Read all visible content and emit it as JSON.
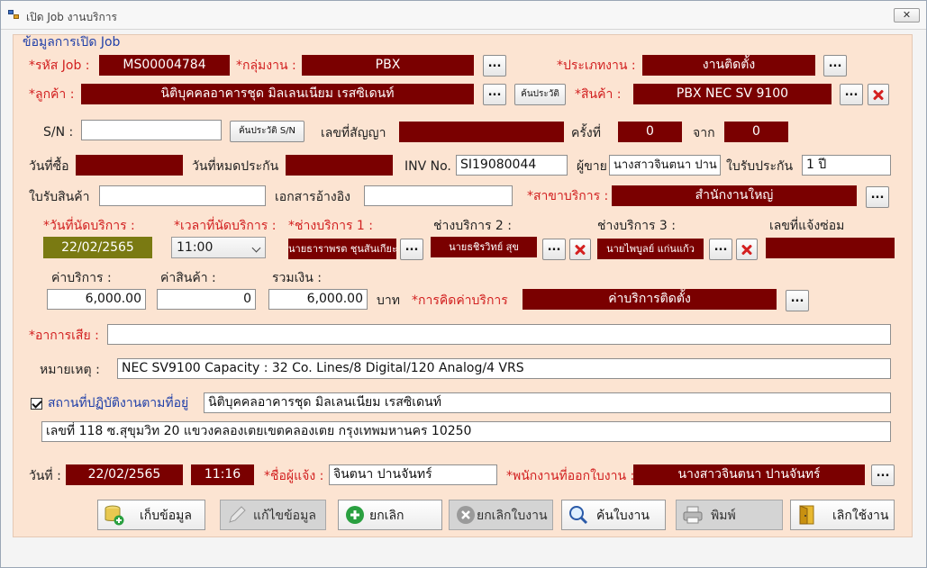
{
  "window": {
    "title": "เปิด Job งานบริการ",
    "close_label": "✕"
  },
  "section_title": "ข้อมูลการเปิด Job",
  "job": {
    "code_label": "*รหัส Job :",
    "code": "MS00004784",
    "group_label": "*กลุ่มงาน :",
    "group": "PBX",
    "type_label": "*ประเภทงาน :",
    "type": "งานติดตั้ง"
  },
  "customer": {
    "label": "*ลูกค้า :",
    "value": "นิติบุคคลอาคารชุด มิลเลนเนียม เรสซิเดนท์",
    "history_button": "ค้นประวัติ",
    "product_label": "*สินค้า :",
    "product": "PBX NEC SV 9100"
  },
  "serial": {
    "label": "S/N :",
    "value": "",
    "history_button": "ค้นประวัติ S/N",
    "contract_label": "เลขที่สัญญา",
    "contract": "",
    "times_label": "ครั้งที่",
    "times": "0",
    "of_label": "จาก",
    "of": "0"
  },
  "purchase": {
    "buy_date_label": "วันที่ซื้อ",
    "buy_date": "",
    "warranty_end_label": "วันที่หมดประกัน",
    "warranty_end": "",
    "inv_label": "INV No.",
    "inv": "SI19080044",
    "seller_label": "ผู้ขาย",
    "seller": "นางสาวจินตนา ปาน",
    "warranty_label": "ใบรับประกัน",
    "warranty": "1 ปี"
  },
  "receipt": {
    "label": "ใบรับสินค้า",
    "value": "",
    "ref_label": "เอกสารอ้างอิง",
    "ref": "",
    "branch_label": "*สาขาบริการ :",
    "branch": "สำนักงานใหญ่"
  },
  "appointment": {
    "date_label": "*วันที่นัดบริการ :",
    "date": "22/02/2565",
    "time_label": "*เวลาที่นัดบริการ :",
    "time": "11:00",
    "tech1_label": "*ช่างบริการ 1 :",
    "tech1": "นายธาราพรต ชุนสันเกียะ",
    "tech2_label": "ช่างบริการ 2 :",
    "tech2": "นายธชิรวิทย์ สุข",
    "tech3_label": "ช่างบริการ 3 :",
    "tech3": "นายไพบูลย์ แก่นแก้ว",
    "repair_label": "เลขที่แจ้งซ่อม",
    "repair": ""
  },
  "cost": {
    "service_label": "ค่าบริการ :",
    "service": "6,000.00",
    "product_label": "ค่าสินค้า :",
    "product": "0",
    "total_label": "รวมเงิน :",
    "total": "6,000.00",
    "currency": "บาท",
    "charge_label": "*การคิดค่าบริการ",
    "charge": "ค่าบริการติดตั้ง"
  },
  "symptom": {
    "label": "*อาการเสีย :",
    "value": ""
  },
  "note": {
    "label": "หมายเหตุ :",
    "value": "NEC SV9100 Capacity : 32 Co. Lines/8 Digital/120 Analog/4 VRS"
  },
  "site": {
    "label": "สถานที่ปฏิบัติงานตามที่อยู่",
    "checked": true,
    "name": "นิติบุคคลอาคารชุด มิลเลนเนียม เรสซิเดนท์",
    "address": "เลขที่  118  ซ.สุขุมวิท 20  แขวงคลองเตยเขตคลองเตย  กรุงเทพมหานคร  10250"
  },
  "footer_info": {
    "date_label": "วันที่ :",
    "date": "22/02/2565",
    "time": "11:16",
    "informer_label": "*ชื่อผู้แจ้ง :",
    "informer": "จินตนา ปานจันทร์",
    "issuer_label": "*พนักงานที่ออกใบงาน :",
    "issuer": "นางสาวจินตนา ปานจันทร์"
  },
  "common": {
    "dots": "..."
  },
  "actions": {
    "save": "เก็บข้อมูล",
    "edit": "แก้ไขข้อมูล",
    "cancel": "ยกเลิก",
    "cancel_job": "ยกเลิกใบงาน",
    "search": "ค้นใบงาน",
    "print": "พิมพ์",
    "exit": "เลิกใช้งาน"
  },
  "colors": {
    "field_bg": "#7a0000",
    "panel_bg": "#fce4d2",
    "required": "#d22020",
    "date_bg": "#7a7a12"
  }
}
